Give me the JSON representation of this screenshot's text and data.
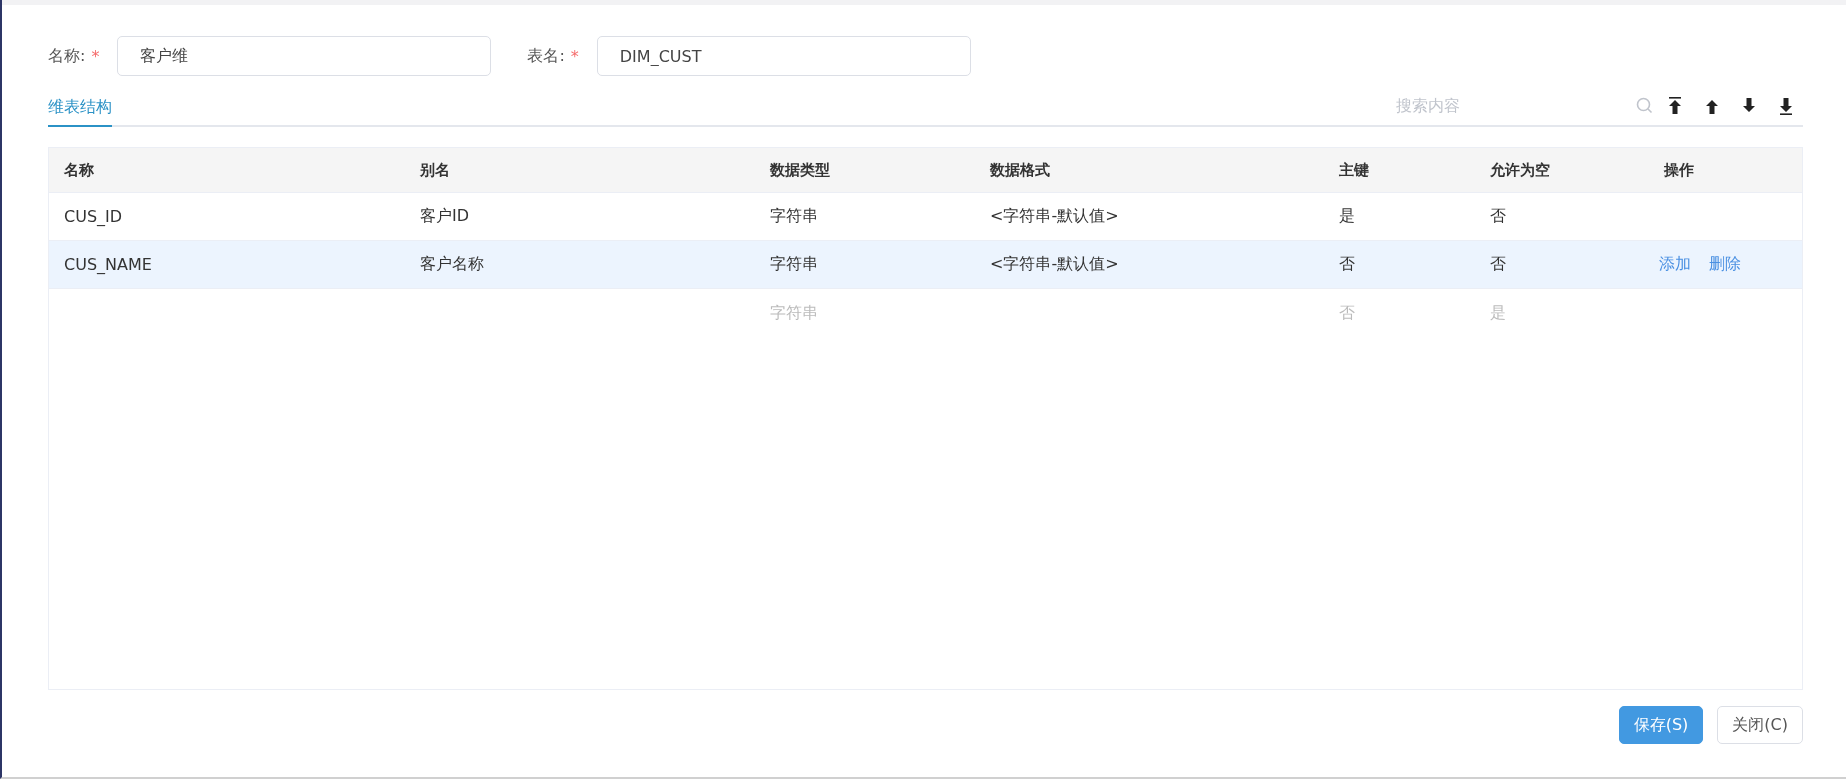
{
  "form": [
    {
      "label": "名称:",
      "required": true,
      "required_mark": "*",
      "value": "客户维"
    },
    {
      "label": "表名:",
      "required": true,
      "required_mark": "*",
      "value": "DIM_CUST"
    }
  ],
  "tabs": [
    {
      "label": "维表结构",
      "selected": true
    }
  ],
  "search": {
    "placeholder": "搜索内容"
  },
  "table": {
    "columns": [
      "名称",
      "别名",
      "数据类型",
      "数据格式",
      "主键",
      "允许为空",
      "操作"
    ],
    "rows": [
      {
        "cells": [
          "CUS_ID",
          "客户ID",
          "字符串",
          "<字符串-默认值>",
          "是",
          "否"
        ],
        "selected": false,
        "disabled": false,
        "actions": []
      },
      {
        "cells": [
          "CUS_NAME",
          "客户名称",
          "字符串",
          "<字符串-默认值>",
          "否",
          "否"
        ],
        "selected": true,
        "disabled": false,
        "actions": [
          "添加",
          "删除"
        ]
      },
      {
        "cells": [
          "",
          "",
          "字符串",
          "",
          "否",
          "是"
        ],
        "selected": false,
        "disabled": true,
        "actions": []
      }
    ]
  },
  "buttons": [
    {
      "label": "保存(S)",
      "kind": "primary"
    },
    {
      "label": "关闭(C)",
      "kind": "default"
    }
  ]
}
